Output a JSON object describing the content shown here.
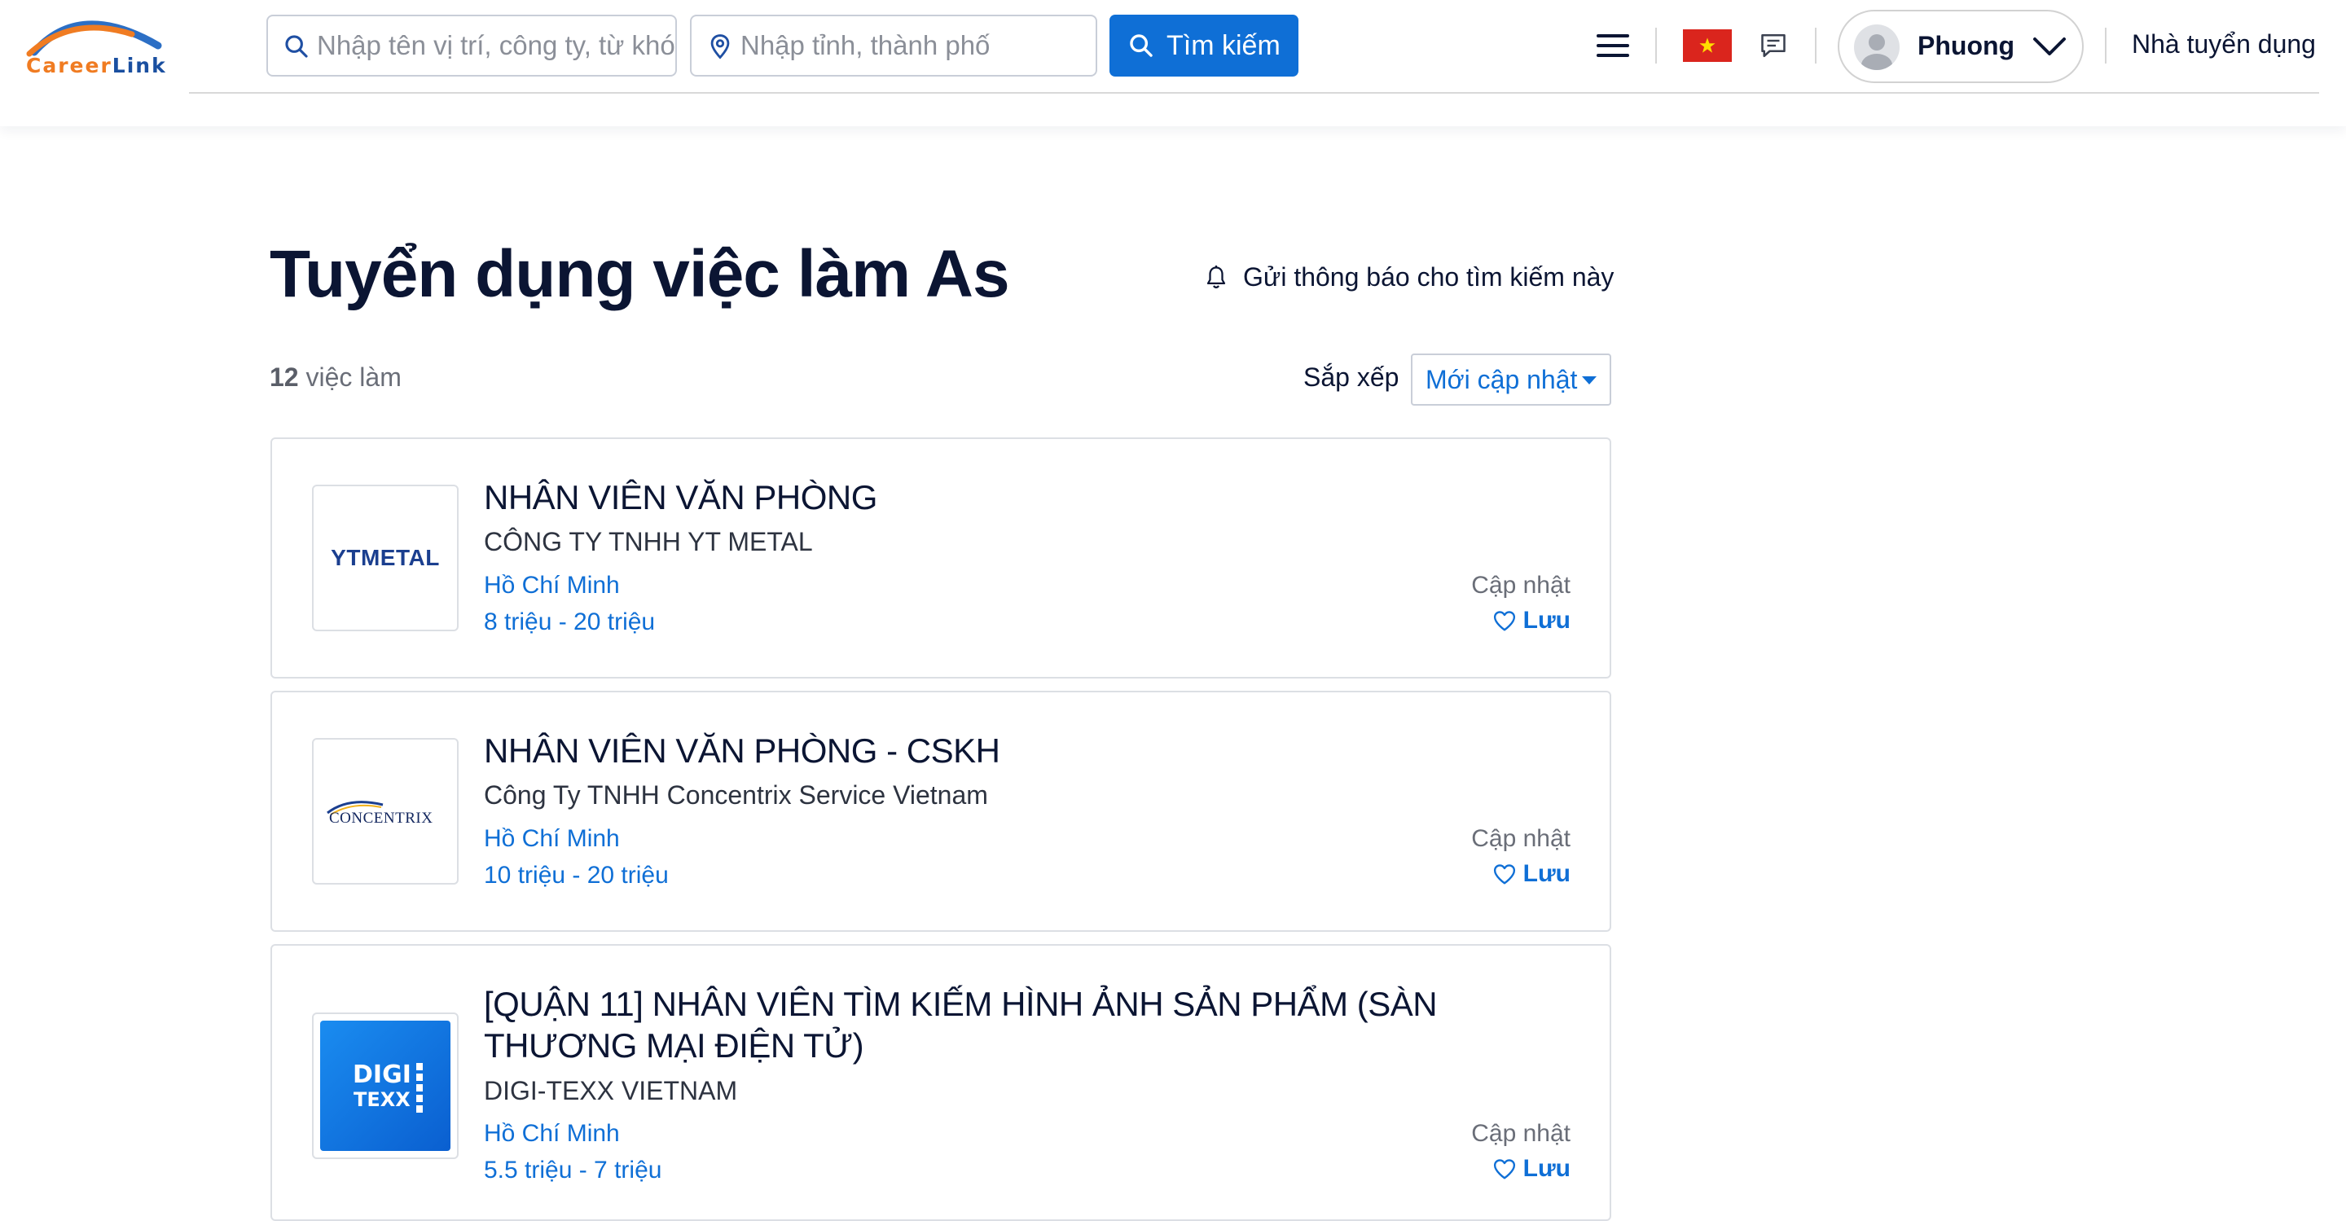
{
  "header": {
    "logo": {
      "text_part1": "Career",
      "text_part2": "Link",
      "text_part3": ""
    },
    "search": {
      "keyword_placeholder": "Nhập tên vị trí, công ty, từ khóa",
      "location_placeholder": "Nhập tỉnh, thành phố",
      "button_label": "Tìm kiếm"
    },
    "user": {
      "name": "Phuong"
    },
    "employer_link": "Nhà tuyển dụng",
    "colors": {
      "brand_blue": "#0f6fd6",
      "flag_red": "#da251d",
      "flag_star": "#ffde00"
    },
    "icons": [
      "search-icon",
      "location-pin-icon",
      "hamburger-menu-icon",
      "vietnam-flag-icon",
      "chat-icon",
      "user-avatar-icon",
      "chevron-down-icon"
    ]
  },
  "main": {
    "title": "Tuyển dụng việc làm As",
    "notify_label": "Gửi thông báo cho tìm kiếm này",
    "job_count_number": "12",
    "job_count_suffix": " việc làm",
    "sort_label": "Sắp xếp",
    "sort_selected": "Mới cập nhật"
  },
  "jobs": [
    {
      "title": "NHÂN VIÊN VĂN PHÒNG",
      "company": "CÔNG TY TNHH YT METAL",
      "location": "Hồ Chí Minh",
      "salary": "8 triệu - 20 triệu",
      "updated": "Cập nhật",
      "save": "Lưu",
      "logo_text": "YTMETAL"
    },
    {
      "title": "NHÂN VIÊN VĂN PHÒNG - CSKH",
      "company": "Công Ty TNHH Concentrix Service Vietnam",
      "location": "Hồ Chí Minh",
      "salary": "10 triệu - 20 triệu",
      "updated": "Cập nhật",
      "save": "Lưu",
      "logo_text": "CONCENTRIX"
    },
    {
      "title": "[QUẬN 11] NHÂN VIÊN TÌM KIẾM HÌNH ẢNH SẢN PHẨM (SÀN THƯƠNG MẠI ĐIỆN TỬ)",
      "company": "DIGI-TEXX VIETNAM",
      "location": "Hồ Chí Minh",
      "salary": "5.5 triệu - 7 triệu",
      "updated": "Cập nhật",
      "save": "Lưu",
      "logo_text_1": "DIGI",
      "logo_text_2": "TEXX"
    }
  ]
}
